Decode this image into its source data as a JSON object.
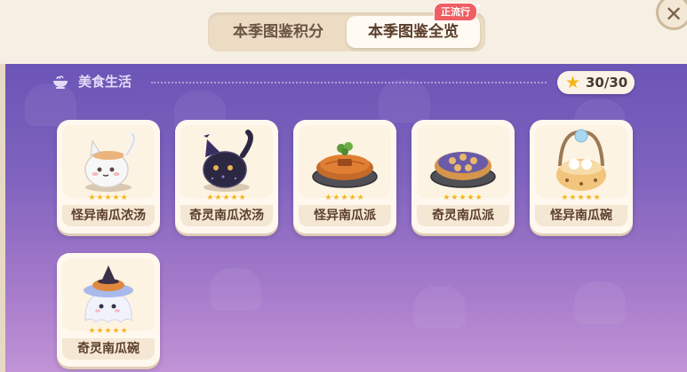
{
  "tabs": [
    {
      "label": "本季图鉴积分",
      "active": false
    },
    {
      "label": "本季图鉴全览",
      "active": true
    }
  ],
  "badge": {
    "label": "正流行"
  },
  "close": {
    "glyph": "✕"
  },
  "section": {
    "title": "美食生活",
    "icon": "bowl-icon"
  },
  "progress": {
    "icon": "star-icon",
    "value": "30/30"
  },
  "items": [
    {
      "name": "怪异南瓜浓汤",
      "stars": "★★★★★",
      "rating": 5,
      "icon": "white-cat-pot-icon"
    },
    {
      "name": "奇灵南瓜浓汤",
      "stars": "★★★★★",
      "rating": 5,
      "icon": "black-cat-pot-icon"
    },
    {
      "name": "怪异南瓜派",
      "stars": "★★★★★",
      "rating": 5,
      "icon": "pumpkin-pie-icon"
    },
    {
      "name": "奇灵南瓜派",
      "stars": "★★★★★",
      "rating": 5,
      "icon": "blueberry-pie-icon"
    },
    {
      "name": "怪异南瓜碗",
      "stars": "★★★★★",
      "rating": 5,
      "icon": "basket-bowl-icon"
    },
    {
      "name": "奇灵南瓜碗",
      "stars": "★★★★★",
      "rating": 5,
      "icon": "ghost-bowl-icon"
    }
  ],
  "colors": {
    "accent": "#f5b61c",
    "badge": "#ef5e63",
    "panel": "#6b55b6"
  }
}
